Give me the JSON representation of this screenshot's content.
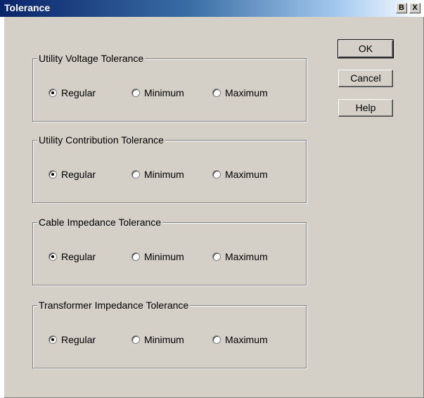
{
  "window": {
    "title": "Tolerance"
  },
  "titlebar": {
    "help_glyph": "B",
    "close_glyph": "X"
  },
  "groups": [
    {
      "label": "Utility Voltage Tolerance",
      "options": [
        "Regular",
        "Minimum",
        "Maximum"
      ],
      "selected": "Regular"
    },
    {
      "label": "Utility Contribution Tolerance",
      "options": [
        "Regular",
        "Minimum",
        "Maximum"
      ],
      "selected": "Regular"
    },
    {
      "label": "Cable Impedance Tolerance",
      "options": [
        "Regular",
        "Minimum",
        "Maximum"
      ],
      "selected": "Regular"
    },
    {
      "label": "Transformer Impedance Tolerance",
      "options": [
        "Regular",
        "Minimum",
        "Maximum"
      ],
      "selected": "Regular"
    }
  ],
  "buttons": {
    "ok": "OK",
    "cancel": "Cancel",
    "help": "Help"
  }
}
